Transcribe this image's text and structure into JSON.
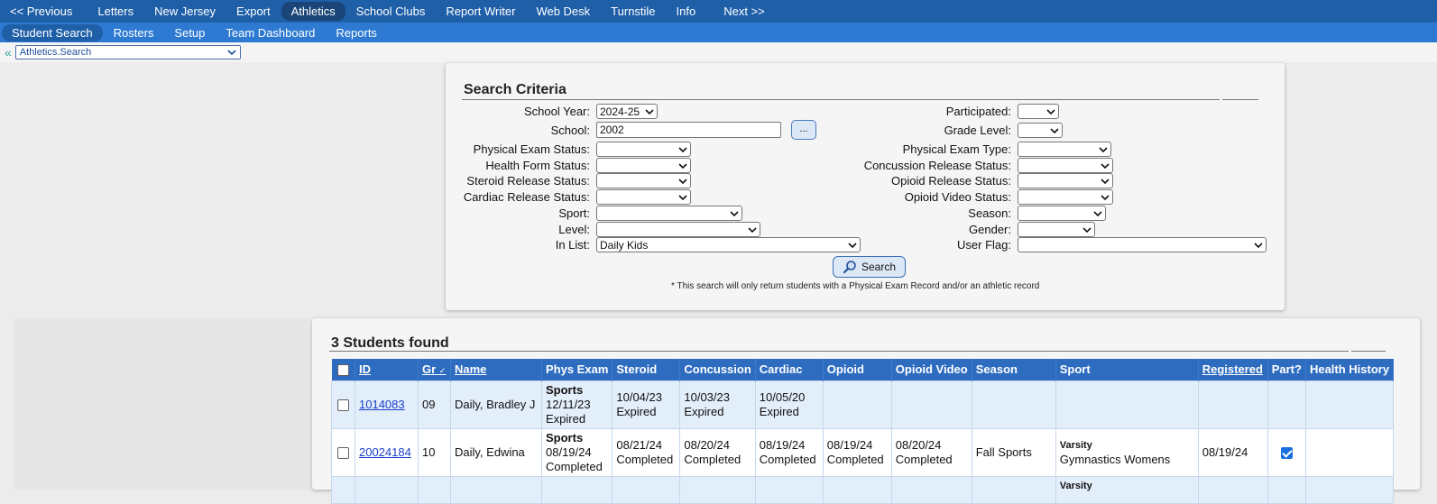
{
  "top_nav": [
    "<< Previous",
    "Letters",
    "New Jersey",
    "Export",
    "Athletics",
    "School Clubs",
    "Report Writer",
    "Web Desk",
    "Turnstile",
    "Info",
    "Next >>"
  ],
  "top_nav_active": "Athletics",
  "sub_nav": [
    "Student Search",
    "Rosters",
    "Setup",
    "Team Dashboard",
    "Reports"
  ],
  "sub_nav_active": "Student Search",
  "breadcrumb_select": "Athletics.Search",
  "criteria": {
    "title": "Search Criteria",
    "labels": {
      "school_year": "School Year:",
      "school": "School:",
      "physical_exam_status": "Physical Exam Status:",
      "health_form_status": "Health Form Status:",
      "steroid_release_status": "Steroid Release Status:",
      "cardiac_release_status": "Cardiac Release Status:",
      "sport": "Sport:",
      "level": "Level:",
      "in_list": "In List:",
      "participated": "Participated:",
      "grade_level": "Grade Level:",
      "physical_exam_type": "Physical Exam Type:",
      "concussion_release_status": "Concussion Release Status:",
      "opioid_release_status": "Opioid Release Status:",
      "opioid_video_status": "Opioid Video Status:",
      "season": "Season:",
      "gender": "Gender:",
      "user_flag": "User Flag:"
    },
    "values": {
      "school_year": "2024-25",
      "school": "2002",
      "in_list": "Daily Kids"
    },
    "ellipsis_label": "...",
    "search_label": "Search",
    "note": "* This search will only return students with a Physical Exam Record and/or an athletic record"
  },
  "results": {
    "title": "3 Students found",
    "columns": [
      "ID",
      "Gr",
      "Name",
      "Phys Exam",
      "Steroid",
      "Concussion",
      "Cardiac",
      "Opioid",
      "Opioid Video",
      "Season",
      "Sport",
      "Registered",
      "Part?",
      "Health History"
    ],
    "rows": [
      {
        "id": "1014083",
        "gr": "09",
        "name": "Daily, Bradley J",
        "phys_type": "Sports",
        "phys_date": "12/11/23",
        "phys_status": "Expired",
        "steroid_date": "10/04/23",
        "steroid_status": "Expired",
        "concussion_date": "10/03/23",
        "concussion_status": "Expired",
        "cardiac_date": "10/05/20",
        "cardiac_status": "Expired",
        "opioid_date": "",
        "opioid_status": "",
        "video_date": "",
        "video_status": "",
        "season": "",
        "sport_level": "",
        "sport_name": "",
        "registered": "",
        "participated": false
      },
      {
        "id": "20024184",
        "gr": "10",
        "name": "Daily, Edwina",
        "phys_type": "Sports",
        "phys_date": "08/19/24",
        "phys_status": "Completed",
        "steroid_date": "08/21/24",
        "steroid_status": "Completed",
        "concussion_date": "08/20/24",
        "concussion_status": "Completed",
        "cardiac_date": "08/19/24",
        "cardiac_status": "Completed",
        "opioid_date": "08/19/24",
        "opioid_status": "Completed",
        "video_date": "08/20/24",
        "video_status": "Completed",
        "season": "Fall Sports",
        "sport_level": "Varsity",
        "sport_name": "Gymnastics Womens",
        "registered": "08/19/24",
        "participated": true
      },
      {
        "id": "",
        "gr": "",
        "name": "",
        "phys_type": "",
        "phys_date": "",
        "phys_status": "",
        "steroid_date": "",
        "steroid_status": "",
        "concussion_date": "",
        "concussion_status": "",
        "cardiac_date": "",
        "cardiac_status": "",
        "opioid_date": "",
        "opioid_status": "",
        "video_date": "",
        "video_status": "",
        "season": "",
        "sport_level": "Varsity",
        "sport_name": "",
        "registered": "",
        "participated": false
      }
    ]
  }
}
